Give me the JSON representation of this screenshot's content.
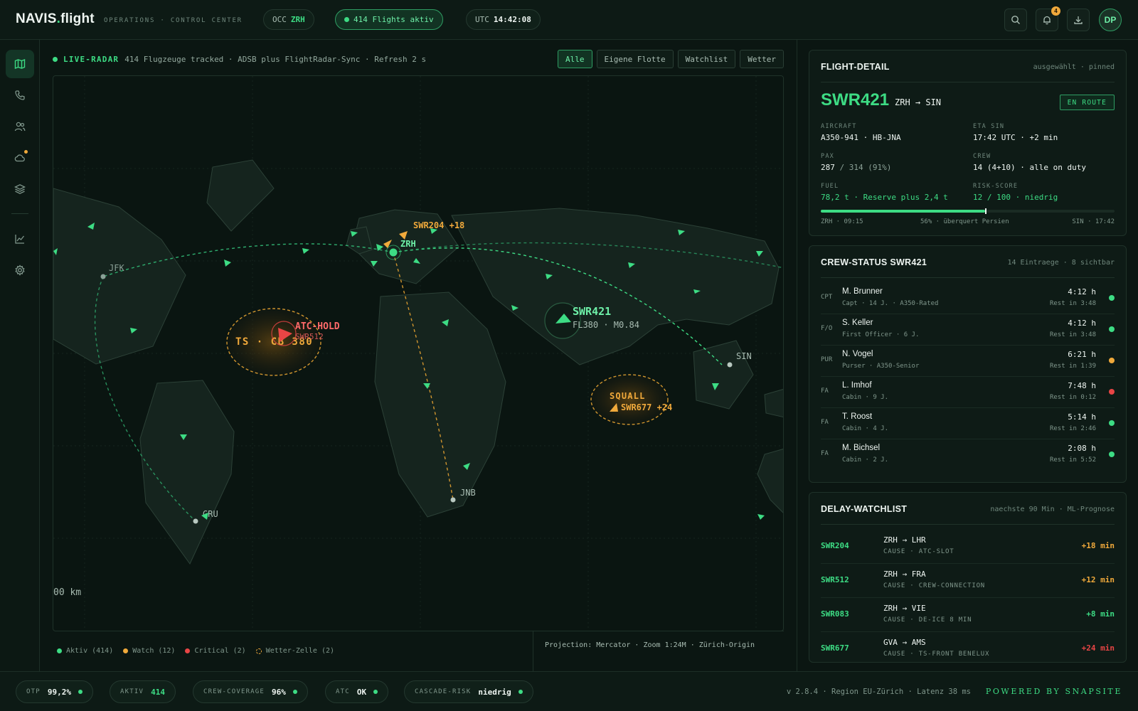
{
  "header": {
    "logo_main": "NAVIS",
    "logo_dot": ".",
    "logo_rest": "flight",
    "subtitle": "OPERATIONS · CONTROL CENTER",
    "occ_label": "OCC",
    "occ_value": "ZRH",
    "flights_active": "414 Flights aktiv",
    "utc_label": "UTC",
    "utc_time": "14:42:08",
    "notifications_count": "4",
    "avatar_initials": "DP"
  },
  "sidebar": {
    "items": [
      "map-icon",
      "phone-icon",
      "users-icon",
      "cloud-icon",
      "layers-icon",
      "chart-icon",
      "gear-icon"
    ],
    "active": "map-icon"
  },
  "radar": {
    "live_label": "LIVE-RADAR",
    "status_text": "414 Flugzeuge tracked · ADSB plus FlightRadar-Sync · Refresh 2 s",
    "filters": [
      "Alle",
      "Eigene Flotte",
      "Watchlist",
      "Wetter"
    ],
    "active_filter": "Alle"
  },
  "map": {
    "airports": {
      "jfk": "JFK",
      "zrh": "ZRH",
      "sin": "SIN",
      "jnb": "JNB",
      "gru": "GRU"
    },
    "selected_flight": {
      "callsign": "SWR421",
      "info": "FL380 · M0.84"
    },
    "watch_flight": {
      "callsign": "SWR204",
      "delay": "+18"
    },
    "atc_hold": {
      "label": "ATC-HOLD",
      "callsign": "SWR512"
    },
    "storm": {
      "label": "TS · CB 380"
    },
    "squall": {
      "label": "SQUALL",
      "flight": "SWR677 +24"
    },
    "scale": "00 km"
  },
  "legend": {
    "aktiv": "Aktiv (414)",
    "watch": "Watch (12)",
    "critical": "Critical (2)",
    "wetter": "Wetter-Zelle (2)"
  },
  "projection": "Projection: Mercator · Zoom 1:24M · Zürich-Origin",
  "flight_detail": {
    "title": "FLIGHT-DETAIL",
    "meta": "ausgewählt · pinned",
    "callsign": "SWR421",
    "route": "ZRH → SIN",
    "status": "EN ROUTE",
    "aircraft_label": "AIRCRAFT",
    "aircraft": "A350-941 · HB-JNA",
    "eta_label": "ETA SIN",
    "eta": "17:42 UTC · +2 min",
    "pax_label": "PAX",
    "pax_value": "287",
    "pax_rest": "/ 314 (91%)",
    "crew_label": "CREW",
    "crew": "14 (4+10) · alle on duty",
    "fuel_label": "FUEL",
    "fuel": "78,2 t · Reserve plus 2,4 t",
    "risk_label": "RISK-SCORE",
    "risk": "12 / 100 · niedrig",
    "progress_fraction": 0.56,
    "progress_start": "ZRH · 09:15",
    "progress_mid": "56% · überquert Persien",
    "progress_end": "SIN · 17:42"
  },
  "crew_status": {
    "title": "CREW-STATUS SWR421",
    "meta": "14 Eintraege · 8 sichtbar",
    "rows": [
      {
        "role": "CPT",
        "name": "M. Brunner",
        "detail": "Capt · 14 J. · A350-Rated",
        "hours": "4:12 h",
        "rest": "Rest in 3:48",
        "status": "ok"
      },
      {
        "role": "F/O",
        "name": "S. Keller",
        "detail": "First Officer · 6 J.",
        "hours": "4:12 h",
        "rest": "Rest in 3:48",
        "status": "ok"
      },
      {
        "role": "PUR",
        "name": "N. Vogel",
        "detail": "Purser · A350-Senior",
        "hours": "6:21 h",
        "rest": "Rest in 1:39",
        "status": "warn"
      },
      {
        "role": "FA",
        "name": "L. Imhof",
        "detail": "Cabin · 9 J.",
        "hours": "7:48 h",
        "rest": "Rest in 0:12",
        "status": "crit"
      },
      {
        "role": "FA",
        "name": "T. Roost",
        "detail": "Cabin · 4 J.",
        "hours": "5:14 h",
        "rest": "Rest in 2:46",
        "status": "ok"
      },
      {
        "role": "FA",
        "name": "M. Bichsel",
        "detail": "Cabin · 2 J.",
        "hours": "2:08 h",
        "rest": "Rest in 5:52",
        "status": "ok"
      }
    ]
  },
  "delay_watchlist": {
    "title": "DELAY-WATCHLIST",
    "meta": "naechste 90 Min · ML-Prognose",
    "rows": [
      {
        "callsign": "SWR204",
        "route": "ZRH → LHR",
        "cause": "CAUSE · ATC-SLOT",
        "delay": "+18 min",
        "level": "warn"
      },
      {
        "callsign": "SWR512",
        "route": "ZRH → FRA",
        "cause": "CAUSE · CREW-CONNECTION",
        "delay": "+12 min",
        "level": "warn"
      },
      {
        "callsign": "SWR083",
        "route": "ZRH → VIE",
        "cause": "CAUSE · DE-ICE 8 MIN",
        "delay": "+8 min",
        "level": "ok"
      },
      {
        "callsign": "SWR677",
        "route": "GVA → AMS",
        "cause": "CAUSE · TS-FRONT BENELUX",
        "delay": "+24 min",
        "level": "crit"
      }
    ]
  },
  "footer": {
    "kpis": [
      {
        "label": "OTP",
        "value": "99,2%"
      },
      {
        "label": "AKTIV",
        "value": "414"
      },
      {
        "label": "CREW-COVERAGE",
        "value": "96%"
      },
      {
        "label": "ATC",
        "value": "OK"
      },
      {
        "label": "CASCADE-RISK",
        "value": "niedrig"
      }
    ],
    "meta": "v 2.8.4 · Region EU-Zürich · Latenz 38 ms",
    "powered": "POWERED BY SNAPSITE"
  },
  "colors": {
    "accent": "#3ddc84",
    "warn": "#f0a93b",
    "crit": "#e84545",
    "background": "#0b1612"
  }
}
